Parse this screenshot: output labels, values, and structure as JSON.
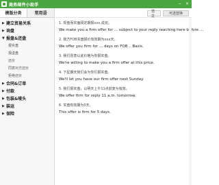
{
  "window": {
    "title": "商务邮件小助手",
    "controls": [
      "−",
      "×"
    ]
  },
  "sidebar": {
    "tabs": [
      {
        "label": "模版分类"
      },
      {
        "label": "常用语"
      }
    ],
    "categories": [
      {
        "label": "建立贸易关系",
        "expanded": false
      },
      {
        "label": "询盘",
        "expanded": false
      },
      {
        "label": "报盘&还盘",
        "expanded": true,
        "items": [
          "报实盘",
          "报虚盘",
          "还价",
          "同意对方还价",
          "拒绝还价"
        ]
      },
      {
        "label": "合同&订单",
        "expanded": false
      },
      {
        "label": "付款",
        "expanded": false
      },
      {
        "label": "包装&唛头",
        "expanded": false
      },
      {
        "label": "装运",
        "expanded": false
      },
      {
        "label": "保险",
        "expanded": false
      }
    ]
  },
  "toolbar": {
    "button1": "范文",
    "button2": "可选替换"
  },
  "entries": [
    {
      "cn": "1. 现盘而实面顾定期报xxx,说完。",
      "en": "We make you a firm offer for … subject to your reply reaching here before …"
    },
    {
      "cn": "2. 我方FOB实盘报价有效期为xxx天。",
      "en": "We offer you firm for … days on FOB .. Basis."
    },
    {
      "cn": "3. 我们愿意以此价格为你报实盘。",
      "en": "We're willing to make you a firm offer at this price."
    },
    {
      "cn": "4. 下星期天我们会为你们报实盘。",
      "en": "We'll let you have our firm offer next Sunday."
    },
    {
      "cn": "5. 我们报实盘，以明天上午11点前复为有效。",
      "en": "We offer firm for reply 11 a.m. tomorrow."
    },
    {
      "cn": "6. 实盘有效期为5天。",
      "en": "This offer is firm for 5 days."
    }
  ]
}
